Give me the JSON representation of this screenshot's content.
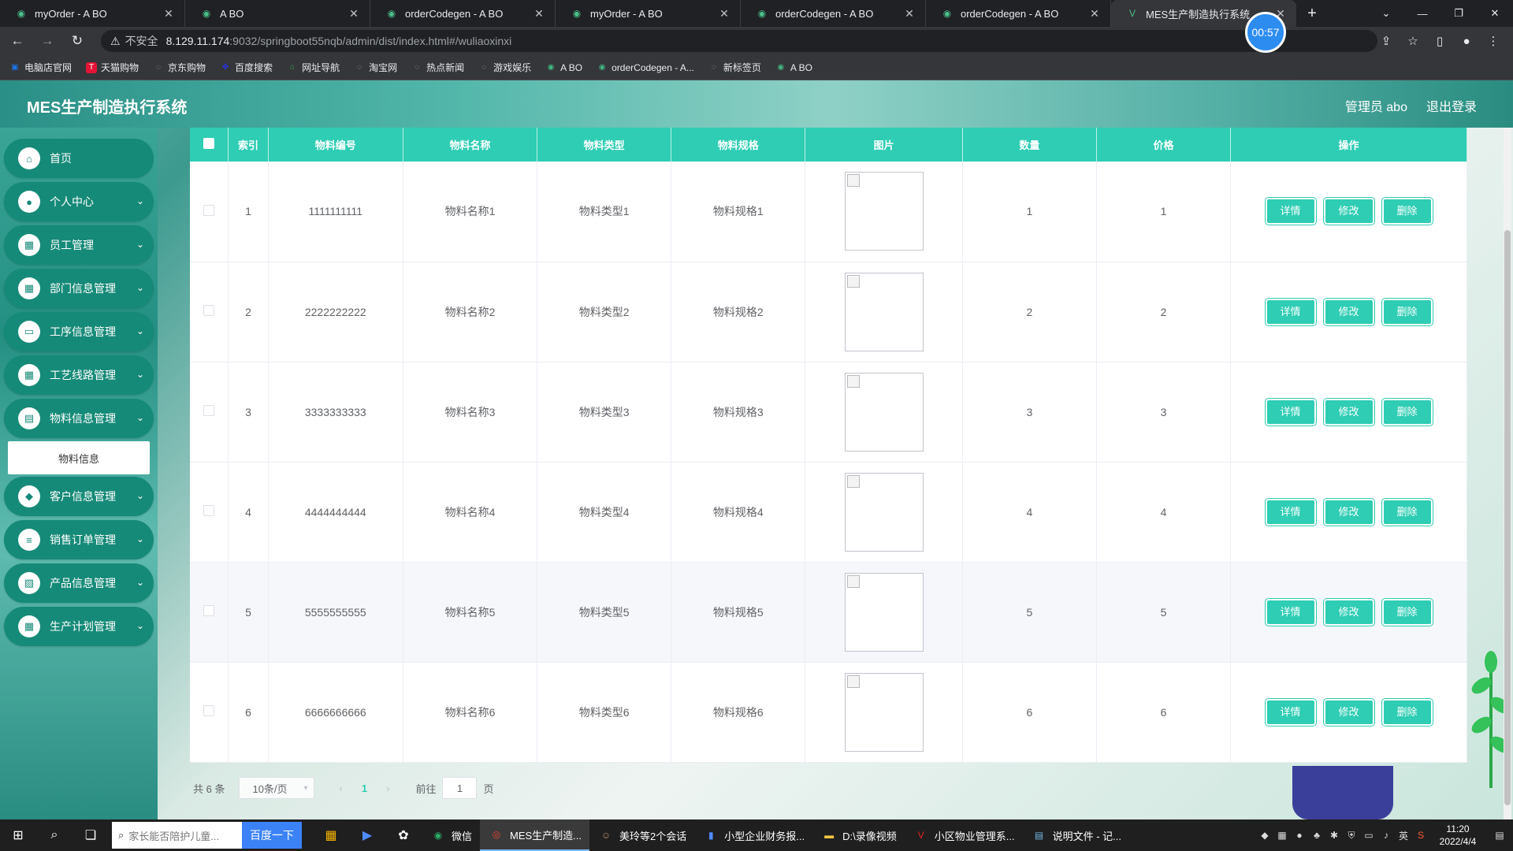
{
  "browser": {
    "tabs": [
      {
        "title": "myOrder - A BO",
        "active": false
      },
      {
        "title": "A BO",
        "active": false
      },
      {
        "title": "orderCodegen - A BO",
        "active": false
      },
      {
        "title": "myOrder - A BO",
        "active": false
      },
      {
        "title": "orderCodegen - A BO",
        "active": false
      },
      {
        "title": "orderCodegen - A BO",
        "active": false
      },
      {
        "title": "MES生产制造执行系统",
        "active": true
      }
    ],
    "new_tab": "+",
    "timer": "00:57",
    "address": {
      "insecure_label": "不安全",
      "host": "8.129.11.174",
      "path": ":9032/springboot55nqb/admin/dist/index.html#/wuliaoxinxi"
    },
    "bookmarks": [
      {
        "label": "电脑店官网",
        "icon": "store-icon"
      },
      {
        "label": "天猫购物",
        "icon": "tmall-icon"
      },
      {
        "label": "京东购物",
        "icon": "globe-icon"
      },
      {
        "label": "百度搜索",
        "icon": "baidu-icon"
      },
      {
        "label": "网址导航",
        "icon": "house-icon"
      },
      {
        "label": "淘宝网",
        "icon": "globe-icon"
      },
      {
        "label": "热点新闻",
        "icon": "globe-icon"
      },
      {
        "label": "游戏娱乐",
        "icon": "globe-icon"
      },
      {
        "label": "A BO",
        "icon": "vue-icon"
      },
      {
        "label": "orderCodegen - A...",
        "icon": "vue-icon"
      },
      {
        "label": "新标签页",
        "icon": "globe-icon"
      },
      {
        "label": "A BO",
        "icon": "vue-icon"
      }
    ]
  },
  "app": {
    "title": "MES生产制造执行系统",
    "user": "管理员 abo",
    "logout": "退出登录",
    "accent": "#2ecdb4"
  },
  "sidebar": {
    "items": [
      {
        "label": "首页",
        "icon": "home-icon",
        "has_children": false
      },
      {
        "label": "个人中心",
        "icon": "user-icon",
        "has_children": true
      },
      {
        "label": "员工管理",
        "icon": "grid-icon",
        "has_children": true
      },
      {
        "label": "部门信息管理",
        "icon": "grid-icon",
        "has_children": true
      },
      {
        "label": "工序信息管理",
        "icon": "monitor-icon",
        "has_children": true
      },
      {
        "label": "工艺线路管理",
        "icon": "grid-icon",
        "has_children": true
      },
      {
        "label": "物料信息管理",
        "icon": "clipboard-icon",
        "has_children": true
      },
      {
        "label": "客户信息管理",
        "icon": "chat-icon",
        "has_children": true
      },
      {
        "label": "销售订单管理",
        "icon": "list-icon",
        "has_children": true
      },
      {
        "label": "产品信息管理",
        "icon": "chart-icon",
        "has_children": true
      },
      {
        "label": "生产计划管理",
        "icon": "grid-icon",
        "has_children": true
      }
    ],
    "submenu": {
      "label": "物料信息"
    }
  },
  "table": {
    "headers": [
      "索引",
      "物料编号",
      "物料名称",
      "物料类型",
      "物料规格",
      "图片",
      "数量",
      "价格",
      "操作"
    ],
    "actions": {
      "detail": "详情",
      "edit": "修改",
      "delete": "删除"
    },
    "rows": [
      {
        "index": "1",
        "code": "1111111111",
        "name": "物料名称1",
        "type": "物料类型1",
        "spec": "物料规格1",
        "qty": "1",
        "price": "1"
      },
      {
        "index": "2",
        "code": "2222222222",
        "name": "物料名称2",
        "type": "物料类型2",
        "spec": "物料规格2",
        "qty": "2",
        "price": "2"
      },
      {
        "index": "3",
        "code": "3333333333",
        "name": "物料名称3",
        "type": "物料类型3",
        "spec": "物料规格3",
        "qty": "3",
        "price": "3"
      },
      {
        "index": "4",
        "code": "4444444444",
        "name": "物料名称4",
        "type": "物料类型4",
        "spec": "物料规格4",
        "qty": "4",
        "price": "4"
      },
      {
        "index": "5",
        "code": "5555555555",
        "name": "物料名称5",
        "type": "物料类型5",
        "spec": "物料规格5",
        "qty": "5",
        "price": "5"
      },
      {
        "index": "6",
        "code": "6666666666",
        "name": "物料名称6",
        "type": "物料类型6",
        "spec": "物料规格6",
        "qty": "6",
        "price": "6"
      }
    ]
  },
  "pagination": {
    "total": "共 6 条",
    "page_size": "10条/页",
    "current_page": "1",
    "goto_prefix": "前往",
    "goto_value": "1",
    "goto_suffix": "页"
  },
  "taskbar": {
    "search_placeholder": "家长能否陪护儿童...",
    "search_button": "百度一下",
    "apps": [
      {
        "label": "微信",
        "icon": "wechat-icon",
        "active": false
      },
      {
        "label": "MES生产制造...",
        "icon": "chrome-icon",
        "active": true
      },
      {
        "label": "美玲等2个会话",
        "icon": "chat-avatar-icon",
        "active": false
      },
      {
        "label": "小型企业财务报...",
        "icon": "doc-icon",
        "active": false
      },
      {
        "label": "D:\\录像视频",
        "icon": "folder-icon",
        "active": false
      },
      {
        "label": "小区物业管理系...",
        "icon": "app-icon",
        "active": false
      },
      {
        "label": "说明文件 - 记...",
        "icon": "notepad-icon",
        "active": false
      }
    ],
    "ime": "英",
    "time": "11:20",
    "date": "2022/4/4"
  }
}
